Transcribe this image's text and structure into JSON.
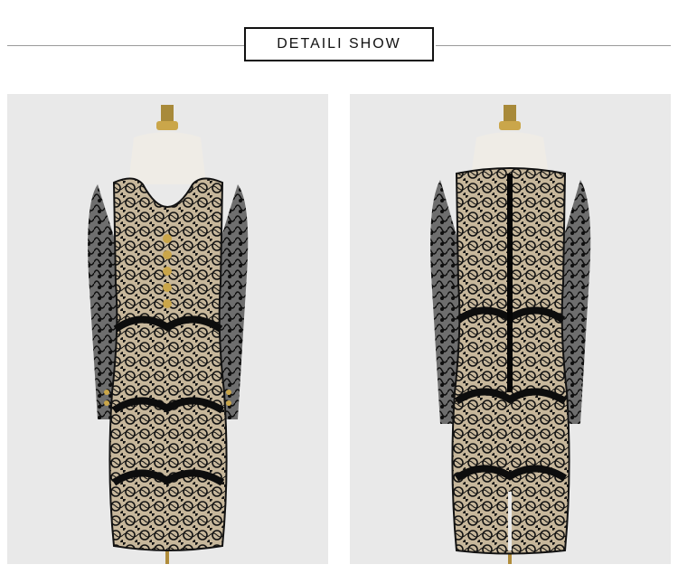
{
  "header": {
    "title": "DETAILI SHOW"
  },
  "photos": [
    {
      "view": "front",
      "description_icon": "dress-front-icon"
    },
    {
      "view": "back",
      "description_icon": "dress-back-icon"
    }
  ],
  "colors": {
    "background": "#ffffff",
    "photo_bg": "#e9e9e9",
    "lace": "#111111",
    "lining": "#c9b89c",
    "gold": "#caa64a",
    "mannequin": "#efece6"
  }
}
